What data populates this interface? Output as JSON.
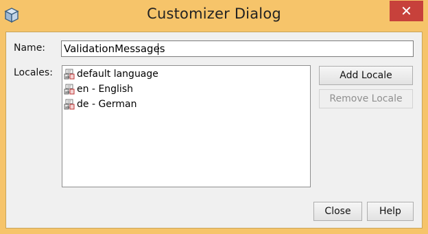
{
  "window": {
    "title": "Customizer Dialog",
    "close_glyph": "✕",
    "app_icon": "cube-icon"
  },
  "form": {
    "name_label": "Name:",
    "name_value": "ValidationMessages",
    "locales_label": "Locales:"
  },
  "locales": [
    {
      "label": "default language",
      "icon": "properties-file-icon"
    },
    {
      "label": "en - English",
      "icon": "properties-file-icon"
    },
    {
      "label": "de - German",
      "icon": "properties-file-icon"
    }
  ],
  "buttons": {
    "add_locale": "Add Locale",
    "remove_locale": "Remove Locale",
    "close": "Close",
    "help": "Help"
  },
  "colors": {
    "frame": "#f6c46a",
    "close_button": "#c7413b",
    "dialog_bg": "#f0f0f0"
  }
}
